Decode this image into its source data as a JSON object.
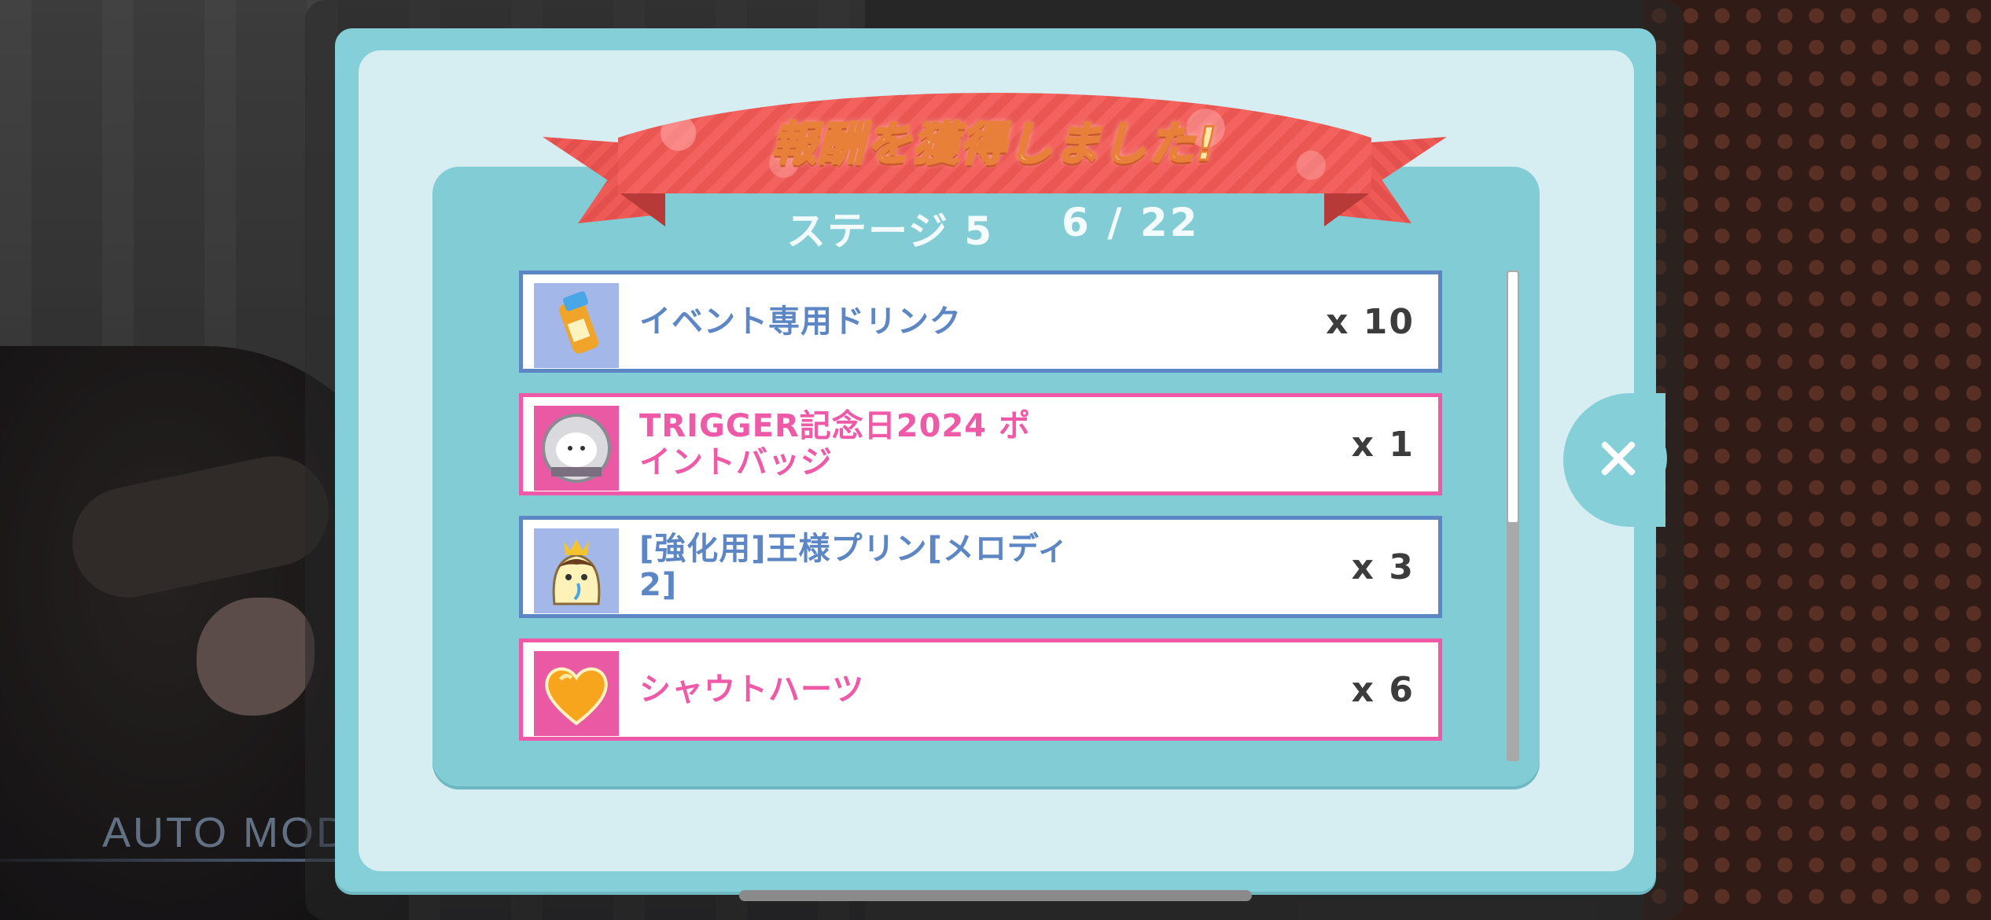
{
  "background": {
    "auto_mode_label": "AUTO MODE"
  },
  "dialog": {
    "title": "報酬を獲得しました!",
    "stage_label": "ステージ 5",
    "progress": "6 / 22"
  },
  "rewards": [
    {
      "name": "イベント専用ドリンク",
      "quantity": "x 10",
      "icon": "energy-drink-icon",
      "frame_color": "#5c86c4"
    },
    {
      "name": "TRIGGER記念日2024 ポイントバッジ",
      "name_line1": "TRIGGER記念日2024 ポ",
      "name_line2": "イントバッジ",
      "quantity": "x 1",
      "icon": "point-badge-icon",
      "frame_color": "#ee5aa8"
    },
    {
      "name": "[強化用]王様プリン[メロディ2]",
      "name_line1": "[強化用]王様プリン[メロディ",
      "name_line2": "2]",
      "quantity": "x 3",
      "icon": "king-pudding-icon",
      "frame_color": "#5c86c4"
    },
    {
      "name": "シャウトハーツ",
      "quantity": "x 6",
      "icon": "heart-icon",
      "frame_color": "#ee5aa8"
    }
  ],
  "colors": {
    "panel_teal": "#84cfd8",
    "ribbon_red": "#f3625e",
    "blue_text": "#5c86c4",
    "pink_text": "#ee5aa8"
  }
}
